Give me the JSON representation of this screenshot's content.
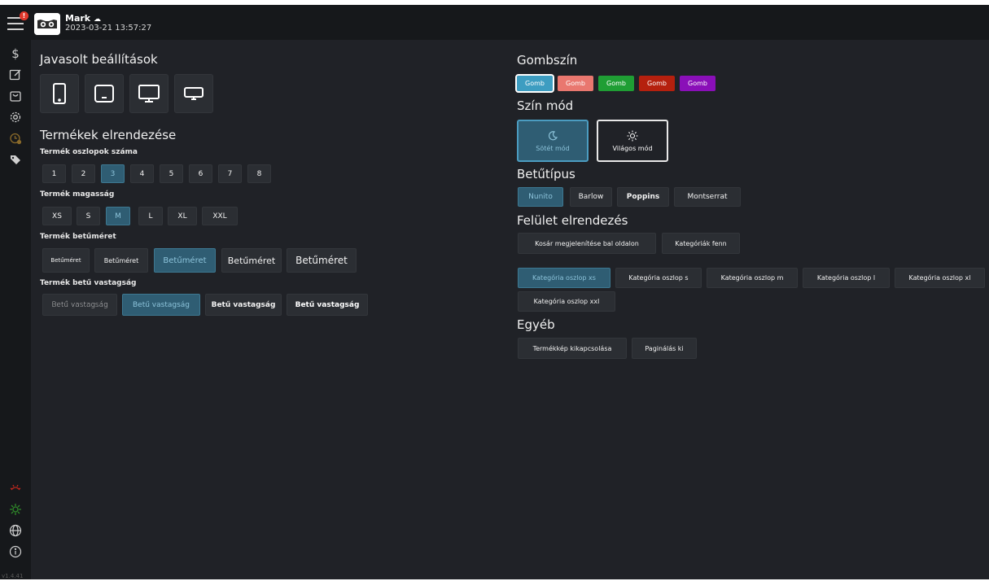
{
  "header": {
    "user_name": "Mark",
    "timestamp": "2023-03-21  13:57:27",
    "notification_count": "!"
  },
  "sidebar": {
    "items": [
      "dollar-icon",
      "edit-icon",
      "cart-icon",
      "settings-icon",
      "clock-icon",
      "tag-icon",
      "bug-icon",
      "sync-icon",
      "globe-icon",
      "info-icon"
    ],
    "version": "v1.4.41"
  },
  "left": {
    "title": "Javasolt beállítások",
    "devices": [
      "phone",
      "tablet",
      "monitor",
      "laptop"
    ],
    "layout_title": "Termékek elrendezése",
    "columns_label": "Termék oszlopok száma",
    "columns": [
      "1",
      "2",
      "3",
      "4",
      "5",
      "6",
      "7",
      "8"
    ],
    "columns_selected": "3",
    "height_label": "Termék magasság",
    "heights": [
      "XS",
      "S",
      "M",
      "L",
      "XL",
      "XXL"
    ],
    "height_selected": "M",
    "fontsize_label": "Termék betűméret",
    "fontsizes": [
      "Betűméret",
      "Betűméret",
      "Betűméret",
      "Betűméret",
      "Betűméret"
    ],
    "fontsize_selected_index": 2,
    "fontweight_label": "Termék betű vastagság",
    "fontweights": [
      "Betű vastagság",
      "Betű vastagság",
      "Betű vastagság",
      "Betű vastagság"
    ],
    "fontweight_selected_index": 1
  },
  "right": {
    "button_color_title": "Gombszín",
    "button_colors": [
      {
        "label": "Gomb",
        "color": "#3d9dc1"
      },
      {
        "label": "Gomb",
        "color": "#e9776f"
      },
      {
        "label": "Gomb",
        "color": "#1f9e34"
      },
      {
        "label": "Gomb",
        "color": "#b5200e"
      },
      {
        "label": "Gomb",
        "color": "#8a0fb8"
      }
    ],
    "color_mode_title": "Szín mód",
    "dark_mode_label": "Sötét mód",
    "light_mode_label": "Világos mód",
    "font_title": "Betűtípus",
    "fonts": [
      "Nunito",
      "Barlow",
      "Poppins",
      "Montserrat"
    ],
    "font_selected": "Nunito",
    "ui_layout_title": "Felület elrendezés",
    "cart_left_label": "Kosár megjelenítése bal oldalon",
    "categories_top_label": "Kategóriák fenn",
    "category_columns": [
      "Kategória oszlop xs",
      "Kategória oszlop s",
      "Kategória oszlop m",
      "Kategória oszlop l",
      "Kategória oszlop xl",
      "Kategória oszlop xxl"
    ],
    "category_selected": "Kategória oszlop xs",
    "other_title": "Egyéb",
    "disable_image_label": "Termékkép kikapcsolása",
    "pagination_off_label": "Paginálás ki"
  }
}
